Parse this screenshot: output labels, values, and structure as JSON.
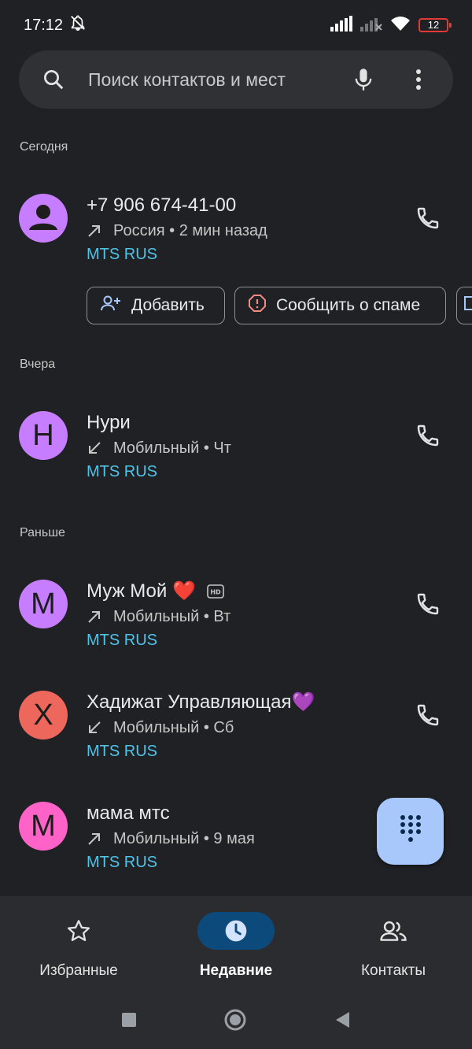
{
  "status_bar": {
    "time": "17:12",
    "battery_level": "12"
  },
  "search": {
    "placeholder": "Поиск контактов и мест"
  },
  "sections": {
    "today": "Сегодня",
    "yesterday": "Вчера",
    "earlier": "Раньше"
  },
  "calls": [
    {
      "initial": "",
      "avatar_color": "#c77dff",
      "name": "+7 906 674-41-00",
      "direction": "outgoing",
      "detail": "Россия • 2 мин назад",
      "carrier": "MTS RUS",
      "has_hd": false
    },
    {
      "initial": "Н",
      "avatar_color": "#c77dff",
      "name": "Нури",
      "direction": "incoming",
      "detail": "Мобильный • Чт",
      "carrier": "MTS RUS",
      "has_hd": false
    },
    {
      "initial": "М",
      "avatar_color": "#c77dff",
      "name": "Муж Мой ❤️",
      "direction": "outgoing",
      "detail": "Мобильный • Вт",
      "carrier": "MTS RUS",
      "has_hd": true
    },
    {
      "initial": "Х",
      "avatar_color": "#ee675c",
      "name": "Хадижат Управляющая💜",
      "direction": "incoming",
      "detail": "Мобильный • Сб",
      "carrier": "MTS RUS",
      "has_hd": false
    },
    {
      "initial": "М",
      "avatar_color": "#ff63c8",
      "name": "мама мтс",
      "direction": "outgoing",
      "detail": "Мобильный • 9 мая",
      "carrier": "MTS RUS",
      "has_hd": false
    }
  ],
  "actions": {
    "add": "Добавить",
    "report_spam": "Сообщить о спаме"
  },
  "bottom_nav": {
    "favorites": "Избранные",
    "recents": "Недавние",
    "contacts": "Контакты",
    "active": "recents"
  },
  "colors": {
    "background": "#202124",
    "accent_link": "#4fc3e8",
    "fab": "#a8c7fa",
    "active_pill": "#0b4a7a"
  }
}
